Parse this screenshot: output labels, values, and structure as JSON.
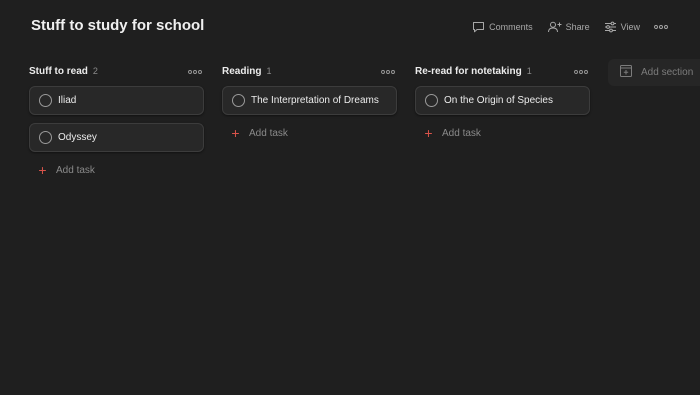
{
  "page": {
    "title": "Stuff to study for school"
  },
  "header": {
    "comments_label": "Comments",
    "share_label": "Share",
    "view_label": "View"
  },
  "columns": [
    {
      "title": "Stuff to read",
      "count": "2",
      "tasks": [
        "Iliad",
        "Odyssey"
      ],
      "add_task_label": "Add task"
    },
    {
      "title": "Reading",
      "count": "1",
      "tasks": [
        "The Interpretation of Dreams"
      ],
      "add_task_label": "Add task"
    },
    {
      "title": "Re-read for notetaking",
      "count": "1",
      "tasks": [
        "On the Origin of Species"
      ],
      "add_task_label": "Add task"
    }
  ],
  "add_section": {
    "label": "Add section"
  },
  "colors": {
    "background": "#1f1f1f",
    "card": "#282828",
    "accent_plus": "#d9534a"
  }
}
